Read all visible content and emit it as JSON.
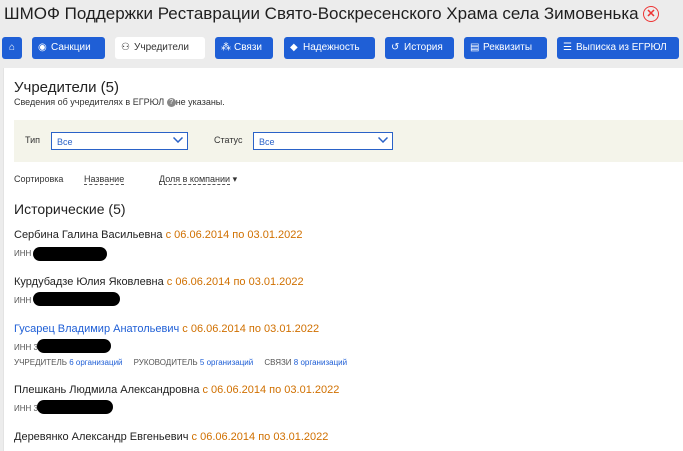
{
  "header": {
    "title": "ШМОФ Поддержки Реставрации Свято-Воскресенского Храма села Зимовенька",
    "close_icon": "✕",
    "accent": "#1f5fd6",
    "close_color": "#e33333"
  },
  "tabs": [
    {
      "label": "",
      "icon": "home-icon",
      "glyph": "⌂"
    },
    {
      "label": "Санкции",
      "icon": "globe-icon",
      "glyph": "◉"
    },
    {
      "label": "Учредители",
      "icon": "people-icon",
      "glyph": "⚇"
    },
    {
      "label": "Связи",
      "icon": "network-icon",
      "glyph": "⁂"
    },
    {
      "label": "Надежность",
      "icon": "shield-icon",
      "glyph": "◆"
    },
    {
      "label": "История",
      "icon": "history-icon",
      "glyph": "↺"
    },
    {
      "label": "Реквизиты",
      "icon": "document-icon",
      "glyph": "▤"
    },
    {
      "label": "Выписка из ЕГРЮЛ",
      "icon": "list-icon",
      "glyph": "☰"
    }
  ],
  "main": {
    "heading": "Учредители (5)",
    "subheading": "Сведения об учредителях в ЕГРЮЛ",
    "subheading_tail": "не указаны.",
    "help_icon": "?"
  },
  "filters": {
    "type_label": "Тип",
    "type_value": "Все",
    "status_label": "Статус",
    "status_value": "Все"
  },
  "sort": {
    "label": "Сортировка",
    "by_name": "Название",
    "by_share": "Доля в компании",
    "share_arrow": "▾"
  },
  "historical": {
    "heading": "Исторические (5)",
    "persons": [
      {
        "name": "Сербина Галина Васильевна",
        "dates": "с 06.06.2014 по 03.01.2022",
        "inn_label": "ИНН",
        "inn_prefix": "",
        "link": false
      },
      {
        "name": "Курдубадзе Юлия Яковлевна",
        "dates": "с 06.06.2014 по 03.01.2022",
        "inn_label": "ИНН",
        "inn_prefix": "",
        "link": false
      },
      {
        "name": "Гусарец Владимир Анатольевич",
        "dates": "с 06.06.2014 по 03.01.2022",
        "inn_label": "ИНН",
        "inn_prefix": "3",
        "link": true
      },
      {
        "name": "Плешкань Людмила Александровна",
        "dates": "с 06.06.2014 по 03.01.2022",
        "inn_label": "ИНН",
        "inn_prefix": "3",
        "link": false
      },
      {
        "name": "Деревянко Александр Евгеньевич",
        "dates": "с 06.06.2014 по 03.01.2022",
        "inn_label": "",
        "inn_prefix": "",
        "link": false
      }
    ],
    "roles": {
      "founder_label": "УЧРЕДИТЕЛЬ",
      "founder_count": "6 организаций",
      "manager_label": "РУКОВОДИТЕЛЬ",
      "manager_count": "5 организаций",
      "links_label": "СВЯЗИ",
      "links_count": "8 организаций"
    }
  }
}
